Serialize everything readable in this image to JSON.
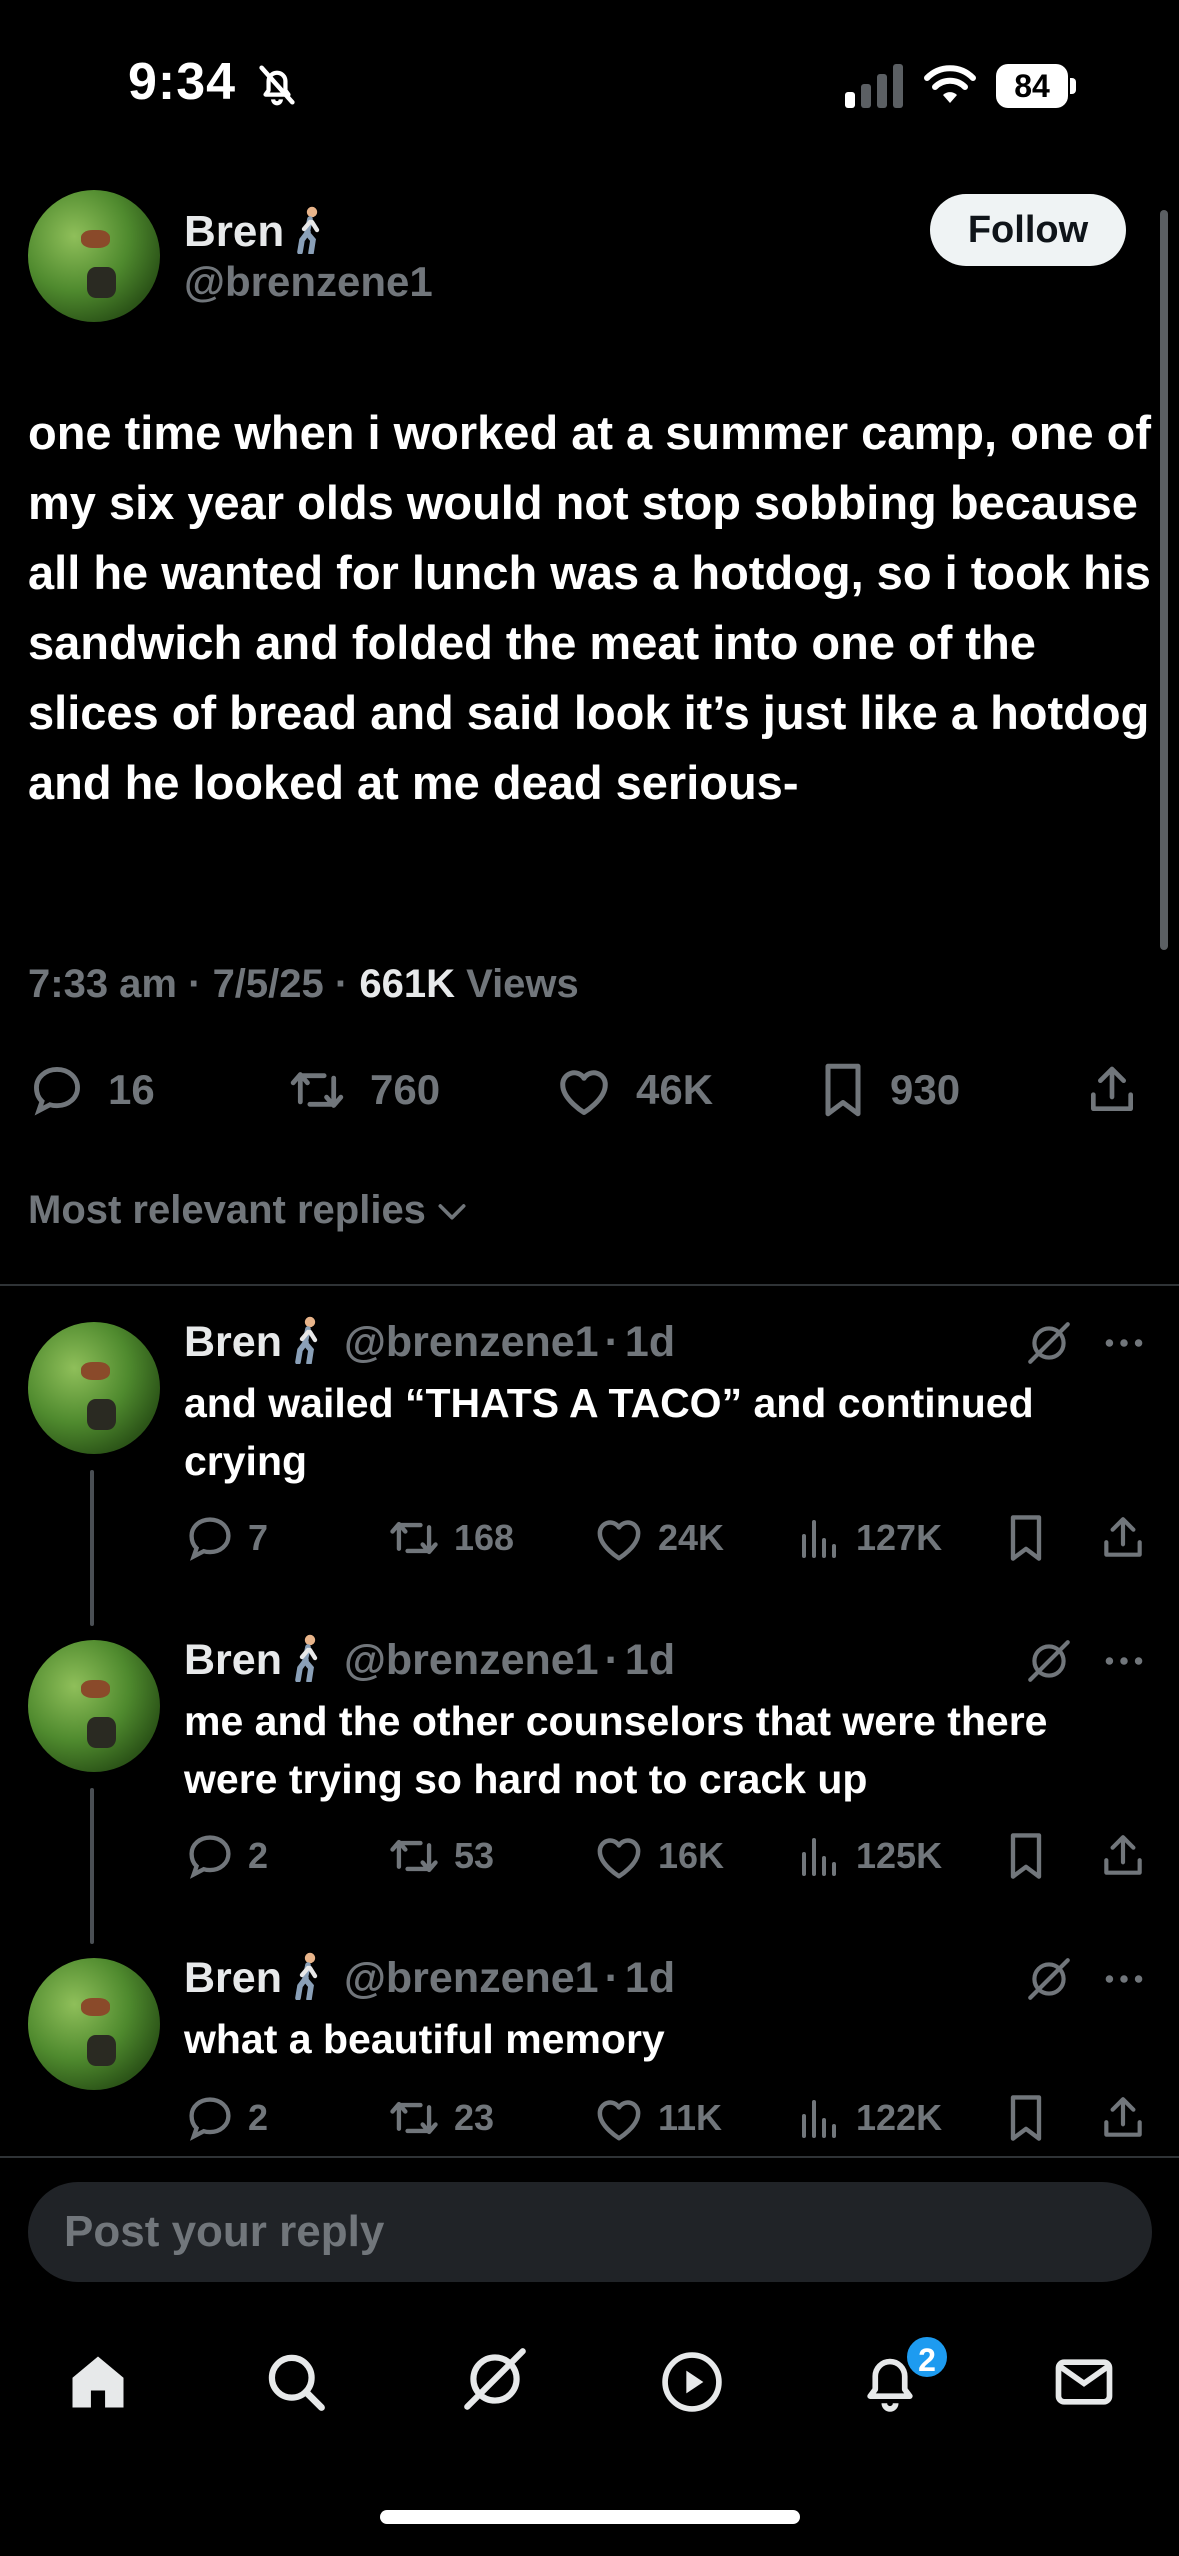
{
  "status_bar": {
    "time": "9:34",
    "battery": "84"
  },
  "post": {
    "author": {
      "name": "Bren",
      "handle": "@brenzene1"
    },
    "follow_label": "Follow",
    "text": "one time when i worked at a summer camp, one of my six year olds would not stop sobbing because all he wanted for lunch was a hotdog, so i took his sandwich and folded the meat into one of the slices of bread and said look it’s just like a hotdog and he looked at me dead serious-",
    "time": "7:33 am",
    "date": "7/5/25",
    "views_count": "661K",
    "views_label": "Views",
    "separator": "·",
    "stats": {
      "replies": "16",
      "reposts": "760",
      "likes": "46K",
      "bookmarks": "930"
    }
  },
  "sort_label": "Most relevant replies",
  "replies": [
    {
      "name": "Bren",
      "handle": "@brenzene1",
      "time": "1d",
      "text": "and wailed “THATS A TACO” and continued crying",
      "replies": "7",
      "reposts": "168",
      "likes": "24K",
      "views": "127K"
    },
    {
      "name": "Bren",
      "handle": "@brenzene1",
      "time": "1d",
      "text": "me and the other counselors that were there were trying so hard not to crack up",
      "replies": "2",
      "reposts": "53",
      "likes": "16K",
      "views": "125K"
    },
    {
      "name": "Bren",
      "handle": "@brenzene1",
      "time": "1d",
      "text": "what a beautiful memory",
      "replies": "2",
      "reposts": "23",
      "likes": "11K",
      "views": "122K"
    }
  ],
  "reply_placeholder": "Post your reply",
  "tabbar": {
    "notifications_badge": "2"
  },
  "colors": {
    "background": "#000000",
    "text": "#e7e9ea",
    "muted": "#71767b",
    "accent": "#1d9bf0"
  },
  "icons": [
    "bell-slash-icon",
    "signal-icon",
    "wifi-icon",
    "battery-icon",
    "walking-person-emoji",
    "reply-icon",
    "repost-icon",
    "like-icon",
    "bookmark-icon",
    "share-icon",
    "views-icon",
    "grok-icon",
    "more-icon",
    "chevron-down-icon",
    "home-icon",
    "search-icon",
    "play-icon",
    "bell-icon",
    "mail-icon"
  ]
}
